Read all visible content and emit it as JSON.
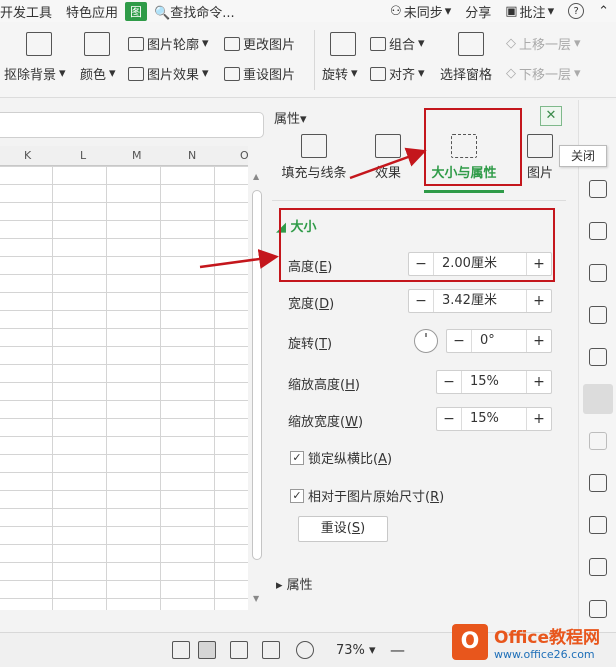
{
  "menu": {
    "items": [
      "开发工具",
      "特色应用"
    ],
    "active_tab": "图",
    "search": "查找命令...",
    "sync": "未同步",
    "share": "分享",
    "comment": "批注",
    "help": "?"
  },
  "ribbon": {
    "remove_bg": "抠除背景",
    "color": "颜色",
    "outline": "图片轮廓",
    "effect": "图片效果",
    "change_pic": "更改图片",
    "reset_pic": "重设图片",
    "rotate": "旋转",
    "group": "组合",
    "align": "对齐",
    "selection_pane": "选择窗格",
    "bring_forward": "上移一层",
    "send_backward": "下移一层"
  },
  "sheet": {
    "columns": [
      "K",
      "L",
      "M",
      "N",
      "O"
    ]
  },
  "panel": {
    "title": "属性",
    "tabs": [
      "填充与线条",
      "效果",
      "大小与属性",
      "图片"
    ],
    "close_tooltip": "关闭",
    "size_section": "大小",
    "height_label": "高度(",
    "height_key": "E",
    "height_value": "2.00厘米",
    "width_label": "宽度(",
    "width_key": "D",
    "width_value": "3.42厘米",
    "rotate_label": "旋转(",
    "rotate_key": "T",
    "rotate_value": "0°",
    "scale_h_label": "缩放高度(",
    "scale_h_key": "H",
    "scale_h_value": "15%",
    "scale_w_label": "缩放宽度(",
    "scale_w_key": "W",
    "scale_w_value": "15%",
    "lock_ratio_label": "锁定纵横比(",
    "lock_ratio_key": "A",
    "relative_label": "相对于图片原始尺寸(",
    "relative_key": "R",
    "reset_label": "重设(",
    "reset_key": "S",
    "props_section": "属性"
  },
  "status": {
    "zoom": "73%"
  },
  "watermark": {
    "brand": "Office教程网",
    "url": "www.office26.com"
  },
  "colors": {
    "accent_green": "#2f9b48",
    "highlight_red": "#c4161c"
  }
}
